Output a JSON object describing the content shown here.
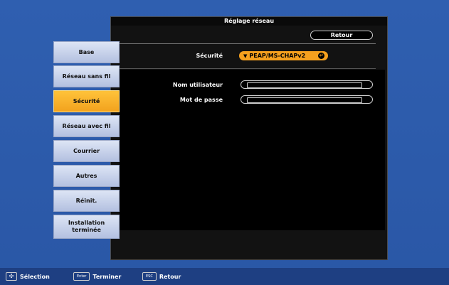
{
  "panel": {
    "title": "Réglage réseau",
    "back_label": "Retour"
  },
  "security": {
    "label": "Sécurité",
    "selected": "PEAP/MS-CHAPv2"
  },
  "fields": {
    "username_label": "Nom utilisateur",
    "username_value": "",
    "password_label": "Mot de passe",
    "password_value": ""
  },
  "sidebar": {
    "items": [
      {
        "label": "Base"
      },
      {
        "label": "Réseau sans fil"
      },
      {
        "label": "Sécurité"
      },
      {
        "label": "Réseau avec fil"
      },
      {
        "label": "Courrier"
      },
      {
        "label": "Autres"
      },
      {
        "label": "Réinit."
      },
      {
        "label": "Installation terminée"
      }
    ],
    "active_index": 2
  },
  "footer": {
    "select_label": "Sélection",
    "enter_key": "Enter",
    "enter_label": "Terminer",
    "esc_key": "ESC",
    "esc_label": "Retour"
  },
  "colors": {
    "background": "#2c5aa8",
    "panel": "#121212",
    "accent_orange": "#f5a01e",
    "sidebar_item": "#c5d0ea"
  }
}
